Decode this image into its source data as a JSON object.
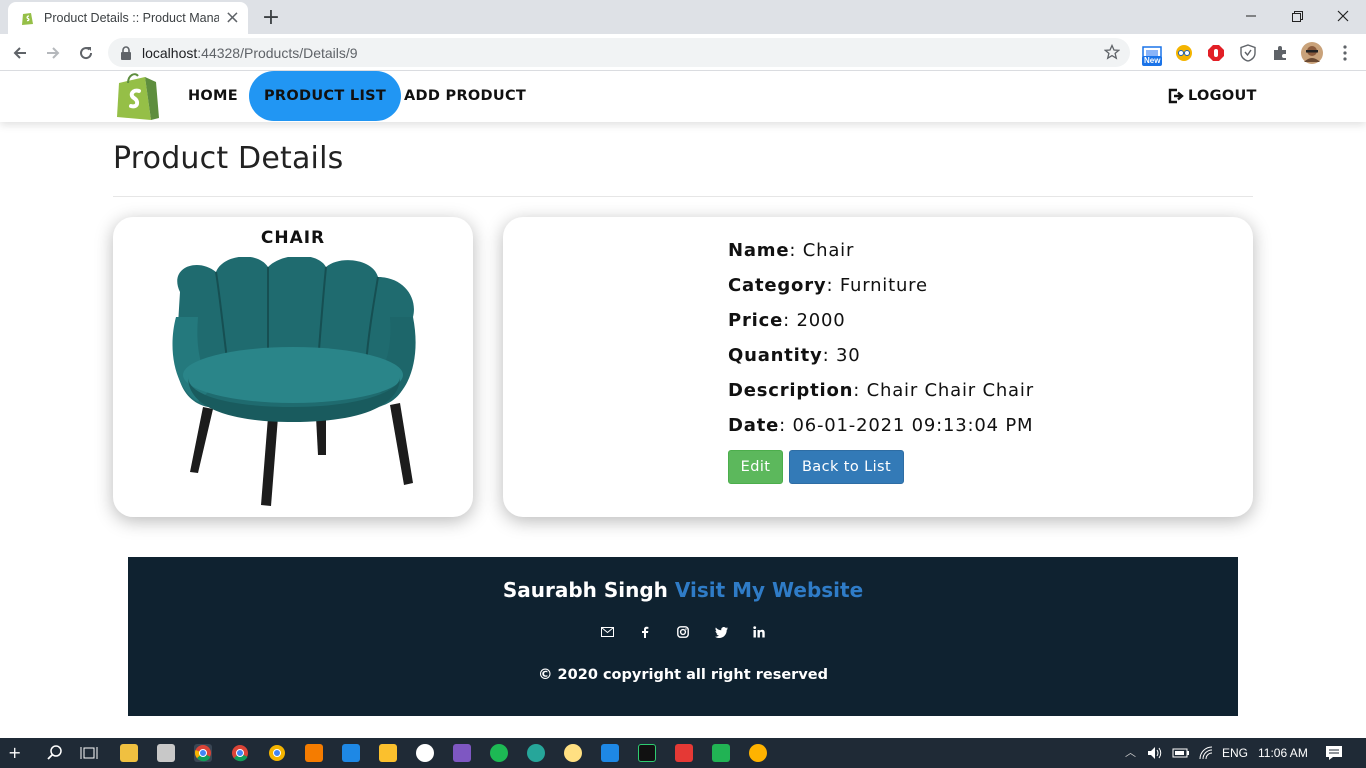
{
  "browser": {
    "tab_title": "Product Details :: Product Manag",
    "url_host": "localhost",
    "url_rest": ":44328/Products/Details/9",
    "ext_new_badge": "New"
  },
  "nav": {
    "home": "HOME",
    "product_list": "PRODUCT LIST",
    "add_product": "ADD PRODUCT",
    "logout": "LOGOUT"
  },
  "page": {
    "title": "Product Details"
  },
  "product": {
    "card_title": "CHAIR",
    "fields": [
      {
        "label": "Name",
        "value": ": Chair"
      },
      {
        "label": "Category",
        "value": ": Furniture"
      },
      {
        "label": "Price",
        "value": ": 2000"
      },
      {
        "label": "Quantity",
        "value": ": 30"
      },
      {
        "label": "Description",
        "value": ": Chair Chair Chair"
      },
      {
        "label": "Date",
        "value": ": 06-01-2021 09:13:04 PM"
      }
    ],
    "edit_label": "Edit",
    "back_label": "Back to List"
  },
  "footer": {
    "author": "Saurabh Singh",
    "website_link": "Visit My Website",
    "copyright": "© 2020 copyright all right reserved",
    "social_icons": [
      "email-icon",
      "facebook-icon",
      "instagram-icon",
      "twitter-icon",
      "linkedin-icon"
    ]
  },
  "taskbar": {
    "language": "ENG",
    "time": "11:06 AM"
  },
  "colors": {
    "nav_active": "#2196f3",
    "edit_button": "#5cb85c",
    "back_button": "#337ab7",
    "footer_bg": "#0f2230",
    "footer_link": "#2f7cc7"
  }
}
